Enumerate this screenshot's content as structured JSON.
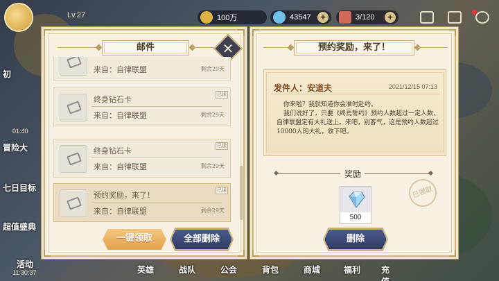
{
  "topbar": {
    "level": "Lv.27",
    "resources": [
      {
        "name": "gold",
        "value": "100万",
        "icon": "coin-icon",
        "color": "#e0b441"
      },
      {
        "name": "diamond",
        "value": "43547",
        "icon": "diamond-icon",
        "color": "#6ec1e8"
      },
      {
        "name": "stamina",
        "value": "3/120",
        "icon": "ticket-icon",
        "color": "#d06a5a"
      }
    ]
  },
  "side_menu": [
    {
      "label": "初",
      "time": ""
    },
    {
      "label": "冒险大",
      "time": "01:40"
    },
    {
      "label": "七日目标",
      "time": ""
    },
    {
      "label": "超值盛典",
      "time": ""
    },
    {
      "label": "活动",
      "time": "11:30:37"
    }
  ],
  "bottom_nav": [
    "英雄",
    "战队",
    "公会",
    "背包",
    "商城",
    "福利",
    "充值"
  ],
  "mail_panel": {
    "title": "邮件",
    "items": [
      {
        "title": "",
        "from": "来自：自律联盟",
        "remain": "剩余29天",
        "tag": ""
      },
      {
        "title": "终身钻石卡",
        "from": "来自：自律联盟",
        "remain": "剩余29天",
        "tag": "已读"
      },
      {
        "title": "终身钻石卡",
        "from": "来自：自律联盟",
        "remain": "剩余29天",
        "tag": "已读"
      },
      {
        "title": "预约奖励，来了！",
        "from": "来自：自律联盟",
        "remain": "剩余29天",
        "tag": "已读"
      }
    ],
    "collect_all_label": "一键领取",
    "delete_all_label": "全部删除"
  },
  "detail_panel": {
    "title": "预约奖励，来了！",
    "sender": "发件人：安道夫",
    "date": "2021/12/15 07:13",
    "body": [
      "你来啦？我就知道你会准时赴约。",
      "我们说好了，只要《终焉誓约》预约人数超过一定人数，自律联盟定有大礼送上。来吧，别客气，这是预约人数超过10000人的大礼，收下吧。"
    ],
    "reward_label": "奖励",
    "reward_count": "500",
    "claimed_stamp": "已领取",
    "delete_label": "删除"
  }
}
